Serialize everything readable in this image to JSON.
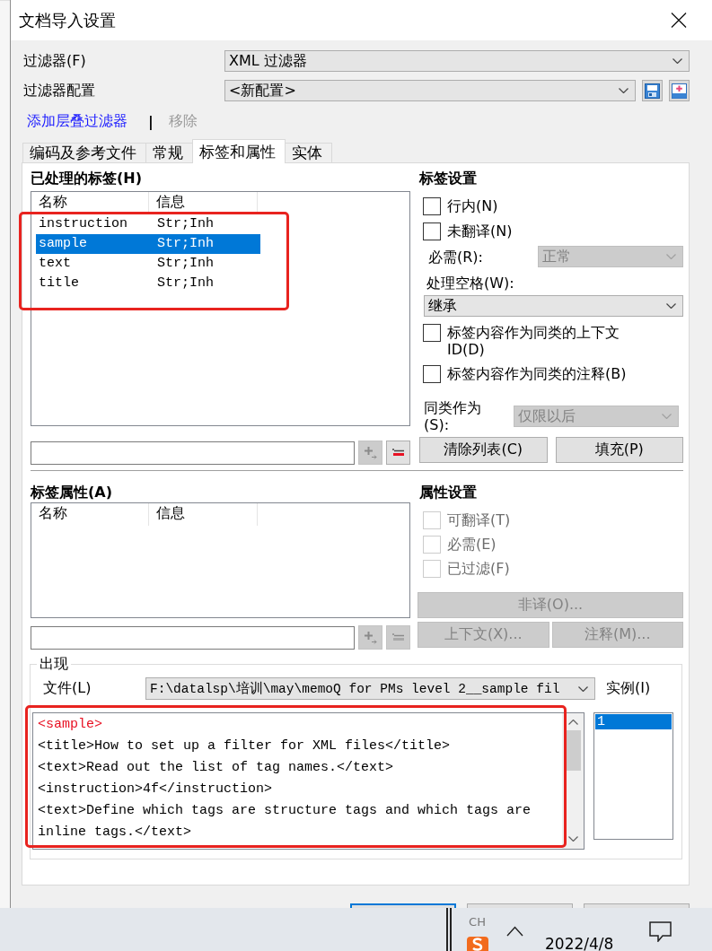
{
  "window": {
    "title": "文档导入设置"
  },
  "filter": {
    "label": "过滤器(F)",
    "value": "XML 过滤器"
  },
  "filter_config": {
    "label": "过滤器配置",
    "value": "<新配置>",
    "buttons": [
      {
        "kind": "save"
      },
      {
        "kind": "add"
      }
    ]
  },
  "cascade": {
    "add": {
      "label": "添加层叠过滤器",
      "disabled": false
    },
    "separator": "|",
    "remove": {
      "label": "移除",
      "disabled": true
    }
  },
  "tabs": [
    {
      "label": "编码及参考文件",
      "selected": false
    },
    {
      "label": "常规",
      "selected": false
    },
    {
      "label": "标签和属性",
      "selected": true
    },
    {
      "label": "实体",
      "selected": false
    }
  ],
  "processed_tags": {
    "title": "已处理的标签(H)",
    "annotated": true,
    "columns": [
      "名称",
      "信息"
    ],
    "rows": [
      {
        "name": "instruction",
        "info": "Str;Inh",
        "selected": false
      },
      {
        "name": "sample",
        "info": "Str;Inh",
        "selected": true
      },
      {
        "name": "text",
        "info": "Str;Inh",
        "selected": false
      },
      {
        "name": "title",
        "info": "Str;Inh",
        "selected": false
      }
    ],
    "tools": [
      {
        "kind": "add",
        "disabled": true
      },
      {
        "kind": "remove",
        "disabled": false
      }
    ]
  },
  "tag_settings": {
    "title": "标签设置",
    "items": [
      {
        "kind": "checkbox",
        "label": "行内(N)",
        "checked": false,
        "disabled": false
      },
      {
        "kind": "checkbox",
        "label": "未翻译(N)",
        "checked": false,
        "disabled": false
      },
      {
        "kind": "inline_select",
        "label": "必需(R):",
        "value": "正常",
        "disabled": true
      },
      {
        "kind": "stacked_select",
        "label": "处理空格(W):",
        "value": "继承",
        "disabled": false
      },
      {
        "kind": "checkbox",
        "label": "标签内容作为同类的上下文 ID(D)",
        "checked": false,
        "disabled": false
      },
      {
        "kind": "checkbox",
        "label": "标签内容作为同类的注释(B)",
        "checked": false,
        "disabled": false
      },
      {
        "kind": "wrapped_select",
        "label": "同类作为(S):",
        "value": "仅限以后",
        "disabled": true
      }
    ],
    "buttons": [
      {
        "label": "清除列表(C)",
        "disabled": false
      },
      {
        "label": "填充(P)",
        "disabled": false
      }
    ]
  },
  "tag_attributes": {
    "title": "标签属性(A)",
    "columns": [
      "名称",
      "信息"
    ],
    "tools": [
      {
        "kind": "add",
        "disabled": true
      },
      {
        "kind": "remove",
        "disabled": true
      }
    ]
  },
  "attribute_settings": {
    "title": "属性设置",
    "checkboxes": [
      {
        "label": "可翻译(T)",
        "checked": false,
        "disabled": true
      },
      {
        "label": "必需(E)",
        "checked": false,
        "disabled": true
      },
      {
        "label": "已过滤(F)",
        "checked": false,
        "disabled": true
      }
    ],
    "button_rows": [
      [
        {
          "label": "非译(O)...",
          "disabled": true
        }
      ],
      [
        {
          "label": "上下文(X)...",
          "disabled": true
        },
        {
          "label": "注释(M)...",
          "disabled": true
        }
      ]
    ]
  },
  "occurrence": {
    "title": "出现",
    "file": {
      "label": "文件(L)",
      "value": "F:\\datalsp\\培训\\may\\memoQ for PMs level 2__sample fil"
    },
    "annotated": true,
    "lines": [
      {
        "text": "<sample>",
        "highlighted": true
      },
      {
        "text": "<title>How to set up a filter for XML files</title>",
        "highlighted": false
      },
      {
        "text": "<text>Read out the list of tag names.</text>",
        "highlighted": false
      },
      {
        "text": "<instruction>4f</instruction>",
        "highlighted": false
      },
      {
        "text": "<text>Define which tags are structure tags and which tags are",
        "highlighted": false
      },
      {
        "text": "inline tags.</text>",
        "highlighted": false
      }
    ],
    "instances": {
      "label": "实例(I)",
      "items": [
        {
          "label": "1",
          "selected": true
        }
      ]
    }
  },
  "footer_buttons": [
    {
      "default": true
    },
    {
      "default": false
    },
    {
      "default": false
    }
  ],
  "taskbar": {
    "language": "CH",
    "date": "2022/4/8"
  }
}
